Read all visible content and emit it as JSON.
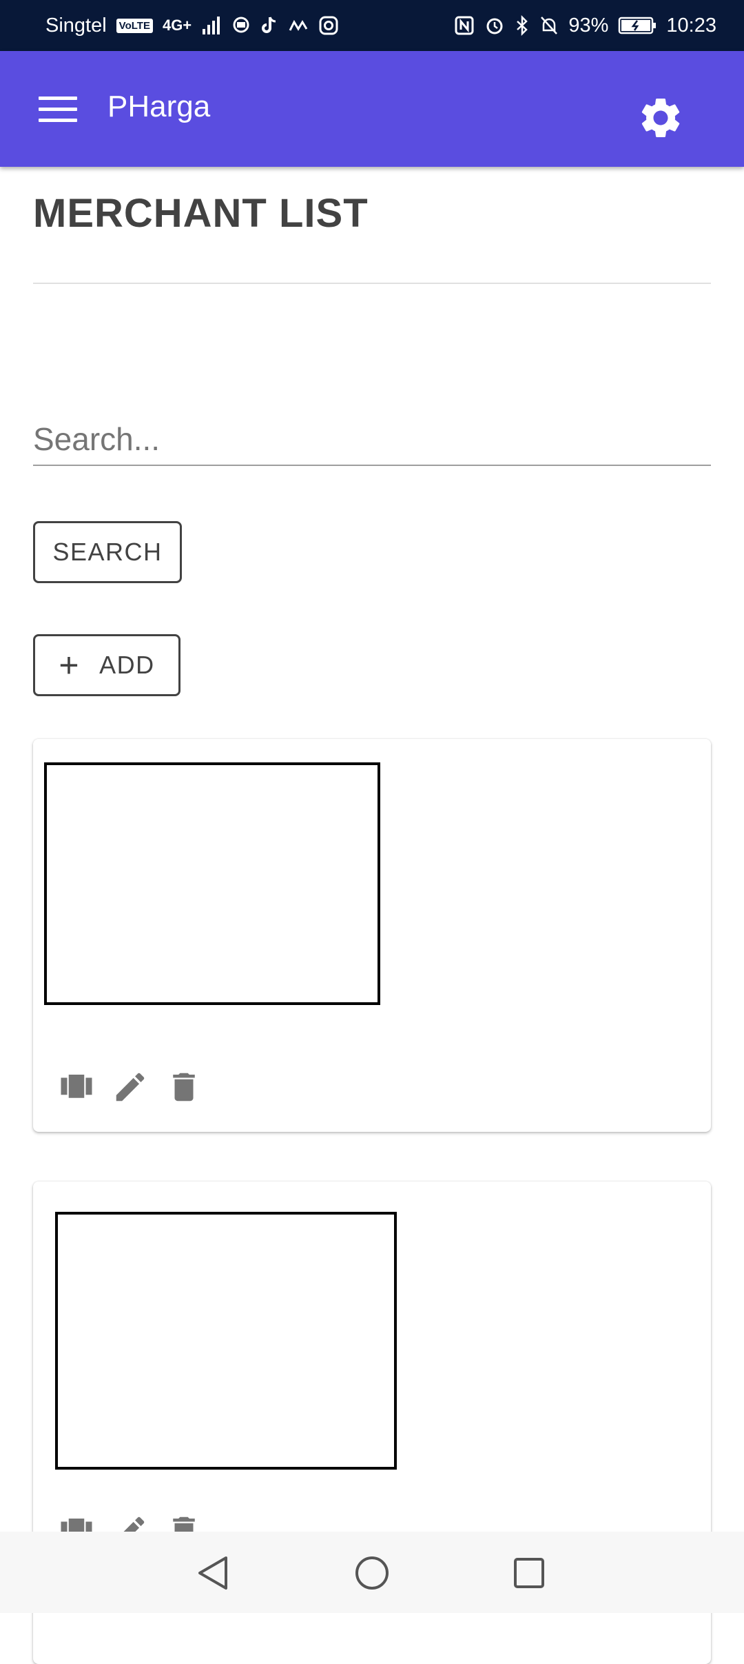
{
  "status_bar": {
    "carrier": "Singtel",
    "volte": "VoLTE",
    "network": "4G+",
    "battery": "93%",
    "time": "10:23"
  },
  "app_bar": {
    "title": "PHarga",
    "menu_icon": "hamburger-menu-icon",
    "settings_icon": "gear-icon",
    "color": "#5a4de0"
  },
  "page": {
    "title": "MERCHANT LIST"
  },
  "search": {
    "placeholder": "Search...",
    "value": "",
    "button_label": "SEARCH"
  },
  "add_button": {
    "label": "ADD",
    "icon": "plus-icon"
  },
  "cards": [
    {
      "actions": [
        "view-carousel-icon",
        "edit-icon",
        "delete-icon"
      ]
    },
    {
      "actions": [
        "view-carousel-icon",
        "edit-icon",
        "delete-icon"
      ]
    }
  ],
  "nav_bar": {
    "icons": [
      "back-triangle-icon",
      "home-circle-icon",
      "recents-square-icon"
    ]
  }
}
